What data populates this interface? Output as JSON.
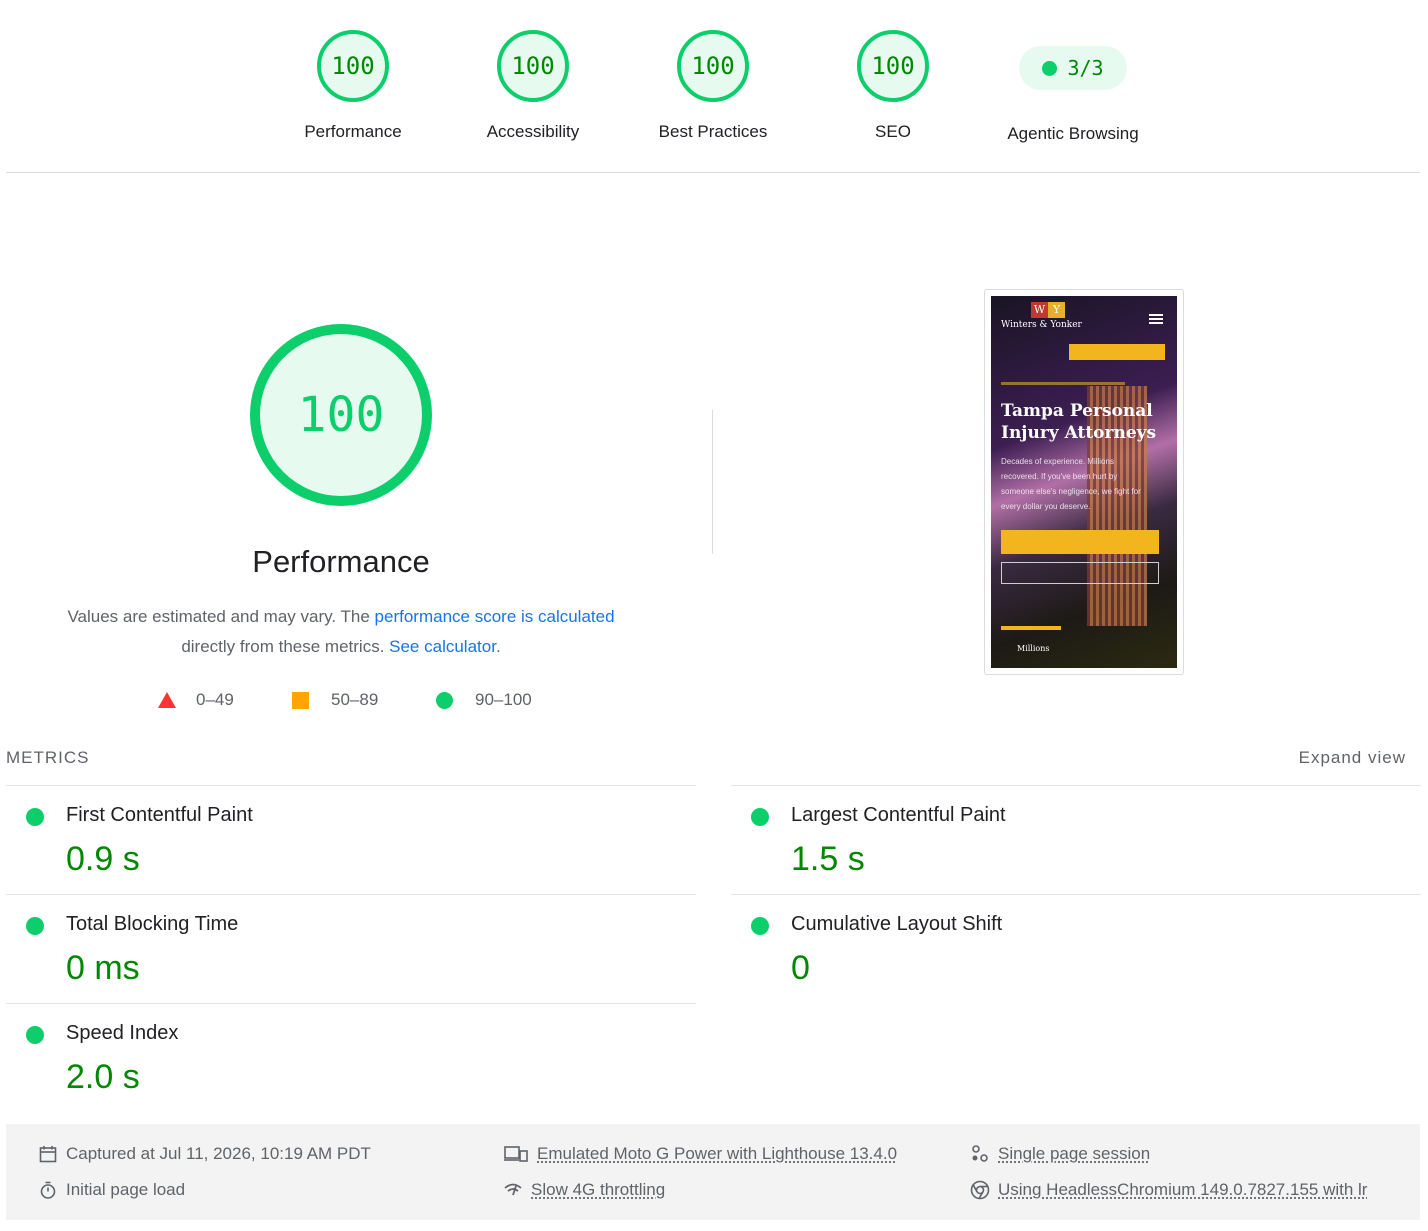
{
  "gauges": [
    {
      "score": "100",
      "label": "Performance"
    },
    {
      "score": "100",
      "label": "Accessibility"
    },
    {
      "score": "100",
      "label": "Best Practices"
    },
    {
      "score": "100",
      "label": "SEO"
    }
  ],
  "agentic": {
    "value": "3/3",
    "label": "Agentic Browsing"
  },
  "performance": {
    "score": "100",
    "title": "Performance",
    "desc_prefix": "Values are estimated and may vary. The ",
    "desc_link1": "performance score is calculated",
    "desc_mid": "directly from these metrics. ",
    "desc_link2": "See calculator",
    "desc_suffix": "."
  },
  "legend": {
    "fail": "0–49",
    "average": "50–89",
    "pass": "90–100"
  },
  "screenshot": {
    "logo_left": "W",
    "logo_right": "Y",
    "brand": "Winters & Yonker",
    "headline_1": "Tampa Personal",
    "headline_2": "Injury Attorneys",
    "body": "Decades of experience. Millions recovered. If you've been hurt by someone else's negligence, we fight for every dollar you deserve.",
    "footer_text": "Millions"
  },
  "metrics": {
    "heading": "METRICS",
    "expand": "Expand view",
    "items": [
      {
        "name": "First Contentful Paint",
        "value": "0.9 s"
      },
      {
        "name": "Largest Contentful Paint",
        "value": "1.5 s"
      },
      {
        "name": "Total Blocking Time",
        "value": "0 ms"
      },
      {
        "name": "Cumulative Layout Shift",
        "value": "0"
      },
      {
        "name": "Speed Index",
        "value": "2.0 s"
      }
    ]
  },
  "footer": {
    "captured": "Captured at Jul 11, 2026, 10:19 AM PDT",
    "load": "Initial page load",
    "device": "Emulated Moto G Power with Lighthouse 13.4.0",
    "throttling": "Slow 4G throttling",
    "session": "Single page session",
    "browser": "Using HeadlessChromium 149.0.7827.155 with lr"
  },
  "colors": {
    "pass": "#0cce6b",
    "pass_text": "#008800",
    "average": "#ffa400",
    "fail": "#ff3333",
    "link": "#1a73e8"
  }
}
